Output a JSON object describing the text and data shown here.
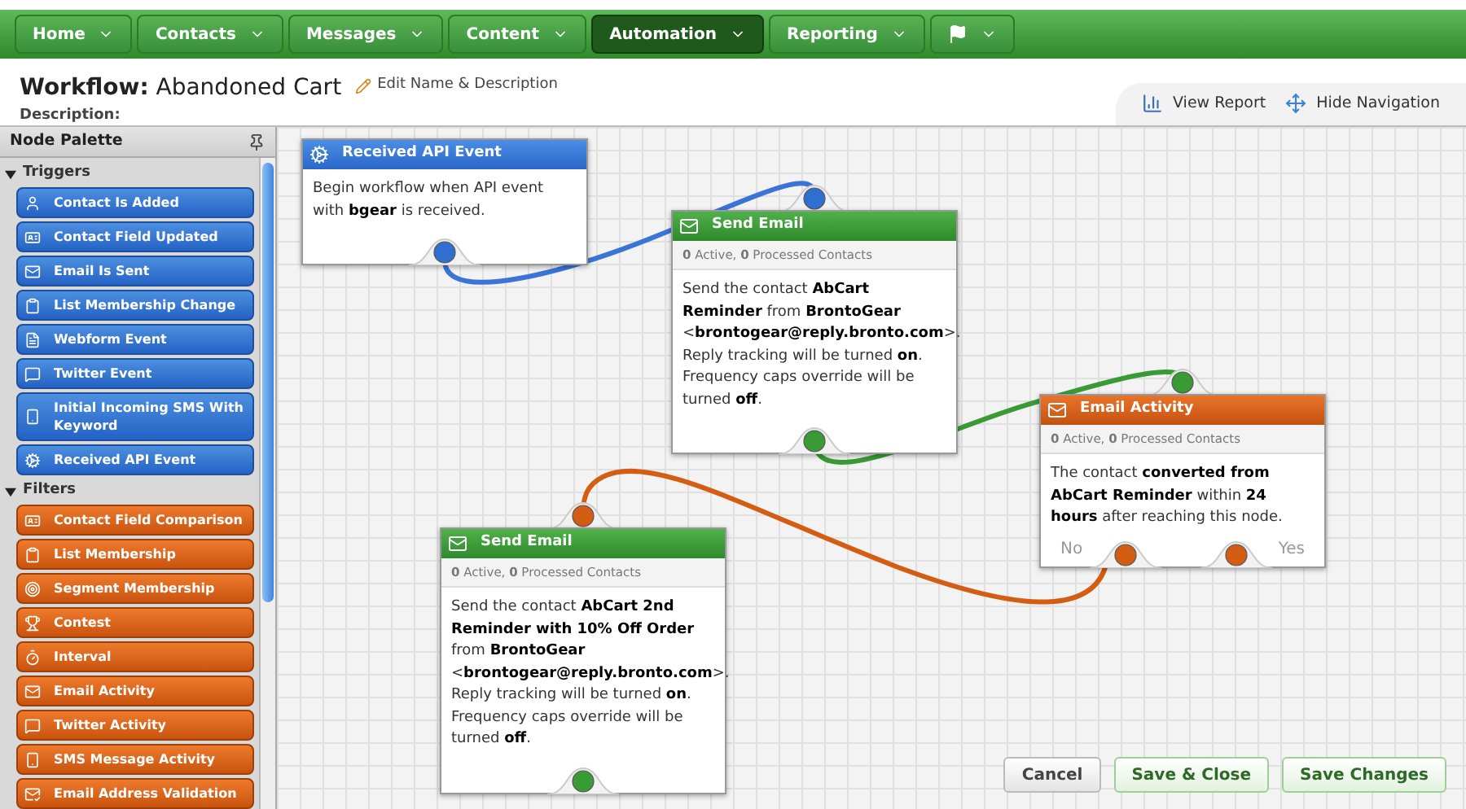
{
  "nav": {
    "items": [
      {
        "label": "Home",
        "selected": false
      },
      {
        "label": "Contacts",
        "selected": false
      },
      {
        "label": "Messages",
        "selected": false
      },
      {
        "label": "Content",
        "selected": false
      },
      {
        "label": "Automation",
        "selected": true
      },
      {
        "label": "Reporting",
        "selected": false
      }
    ]
  },
  "header": {
    "title_prefix": "Workflow:",
    "title": "Abandoned Cart",
    "edit_link": "Edit Name & Description",
    "description_label": "Description:",
    "actions": [
      "View Report",
      "Hide Navigation"
    ]
  },
  "palette": {
    "title": "Node Palette",
    "sections": [
      {
        "title": "Triggers",
        "kind": "trigger",
        "expanded": true,
        "items": [
          "Contact Is Added",
          "Contact Field Updated",
          "Email Is Sent",
          "List Membership Change",
          "Webform Event",
          "Twitter Event",
          "Initial Incoming SMS With Keyword",
          "Received API Event"
        ]
      },
      {
        "title": "Filters",
        "kind": "filter",
        "expanded": true,
        "items": [
          "Contact Field Comparison",
          "List Membership",
          "Segment Membership",
          "Contest",
          "Interval",
          "Email Activity",
          "Twitter Activity",
          "SMS Message Activity",
          "Email Address Validation"
        ]
      }
    ]
  },
  "nodes": [
    {
      "kind": "trigger",
      "title": "Received API Event",
      "body": "Begin workflow when API event with **bgear** is received."
    },
    {
      "kind": "action",
      "title": "Send Email",
      "stats": "**0** Active, **0** Processed Contacts",
      "body": "Send the contact **AbCart Reminder** from **BrontoGear** <**brontogear@reply.bronto.com**>. Reply tracking will be turned **on**. Frequency caps override will be turned **off**."
    },
    {
      "kind": "filter",
      "title": "Email Activity",
      "stats": "**0** Active, **0** Processed Contacts",
      "body": "The contact **converted from AbCart Reminder** within **24 hours** after reaching this node.",
      "outputs": [
        "No",
        "Yes"
      ]
    },
    {
      "kind": "action",
      "title": "Send Email",
      "stats": "**0** Active, **0** Processed Contacts",
      "body": "Send the contact **AbCart 2nd Reminder with 10% Off Order** from **BrontoGear** <**brontogear@reply.bronto.com**>. Reply tracking will be turned **on**. Frequency caps override will be turned **off**."
    }
  ],
  "buttons": [
    {
      "label": "Cancel",
      "kind": "plain"
    },
    {
      "label": "Save & Close",
      "kind": "primary"
    },
    {
      "label": "Save Changes",
      "kind": "primary"
    }
  ]
}
